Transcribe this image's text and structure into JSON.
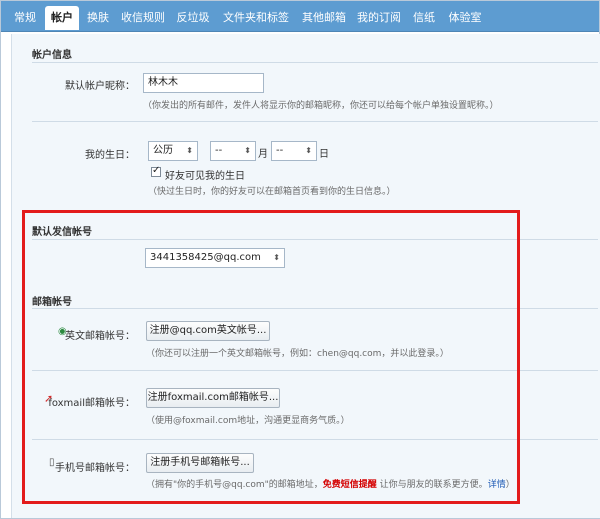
{
  "tabs": [
    "常规",
    "帐户",
    "换肤",
    "收信规则",
    "反垃圾",
    "文件夹和标签",
    "其他邮箱",
    "我的订阅",
    "信纸",
    "体验室"
  ],
  "account_info": {
    "title": "帐户信息",
    "nickname_label": "默认帐户昵称：",
    "nickname_value": "林木木",
    "nickname_desc": "（你发出的所有邮件，发件人将显示你的邮箱昵称，你还可以给每个帐户单独设置昵称。）",
    "birthday_label": "我的生日：",
    "calendar_value": "公历",
    "month_value": "--",
    "month_suffix": "月",
    "day_value": "--",
    "day_suffix": "日",
    "friends_checkbox_label": "好友可见我的生日",
    "birthday_desc": "（快过生日时，你的好友可以在邮箱首页看到你的生日信息。）"
  },
  "default_sender": {
    "title": "默认发信帐号",
    "selected": "3441358425@qq.com"
  },
  "mailbox_accounts": {
    "title": "邮箱帐号",
    "english": {
      "label": "英文邮箱帐号：",
      "button": "注册@qq.com英文帐号...",
      "desc": "（你还可以注册一个英文邮箱帐号，例如：chen@qq.com，并以此登录。）"
    },
    "foxmail": {
      "label": "foxmail邮箱帐号：",
      "button": "注册foxmail.com邮箱帐号...",
      "desc": "（使用@foxmail.com地址，沟通更显商务气质。）"
    },
    "mobile": {
      "label": "手机号邮箱帐号：",
      "button": "注册手机号邮箱帐号...",
      "desc_prefix": "（拥有\"你的手机号@qq.com\"的邮箱地址，",
      "desc_red": "免费短信提醒",
      "desc_mid": " 让你与朋友的联系更方便。",
      "desc_link": "详情",
      "desc_suffix": "）"
    }
  },
  "colors": {
    "tabbar": "#5d9cd1",
    "highlight": "#e31b1b",
    "panel": "#f2f7fb"
  }
}
